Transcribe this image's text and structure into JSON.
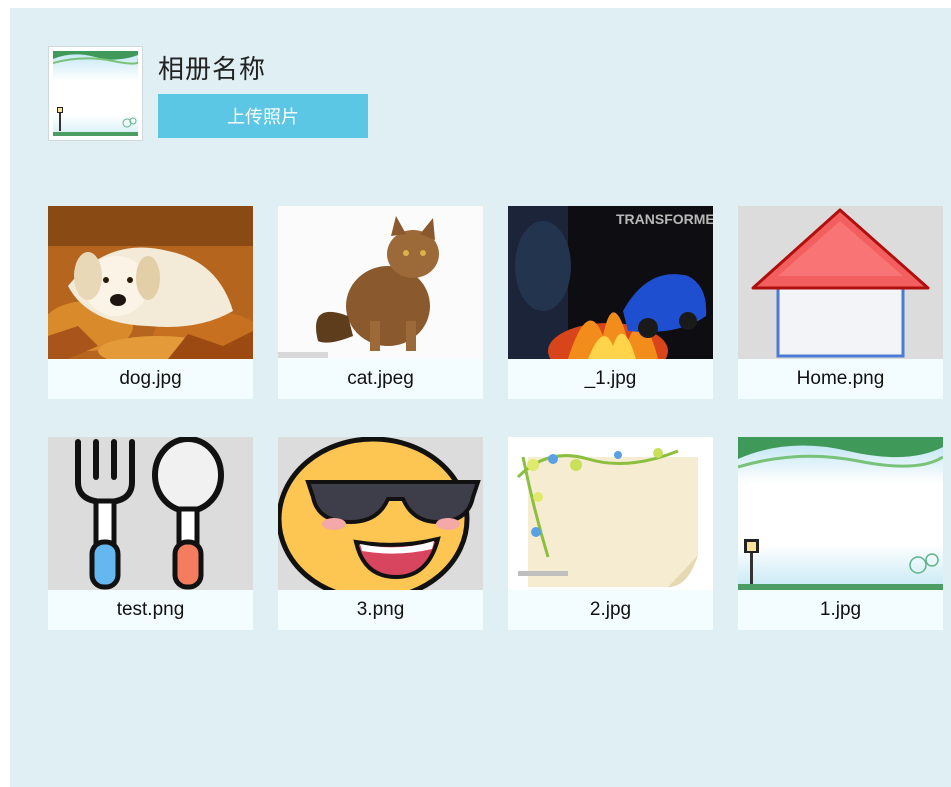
{
  "album": {
    "title": "相册名称",
    "upload_label": "上传照片"
  },
  "photos": [
    {
      "name": "dog.jpg",
      "thumb": "dog-photo"
    },
    {
      "name": "cat.jpeg",
      "thumb": "cat-photo"
    },
    {
      "name": "_1.jpg",
      "thumb": "transformers-poster"
    },
    {
      "name": "Home.png",
      "thumb": "home-icon"
    },
    {
      "name": "test.png",
      "thumb": "fork-spoon-icon"
    },
    {
      "name": "3.png",
      "thumb": "sunglasses-emoji"
    },
    {
      "name": "2.jpg",
      "thumb": "floral-paper"
    },
    {
      "name": "1.jpg",
      "thumb": "lamp-landscape"
    }
  ],
  "thumb_texts": {
    "poster_title": "TRANSFORMERS"
  },
  "colors": {
    "panel_bg": "#e0eff4",
    "upload_button": "#5bc7e4",
    "card_bg": "#f3fcff"
  }
}
